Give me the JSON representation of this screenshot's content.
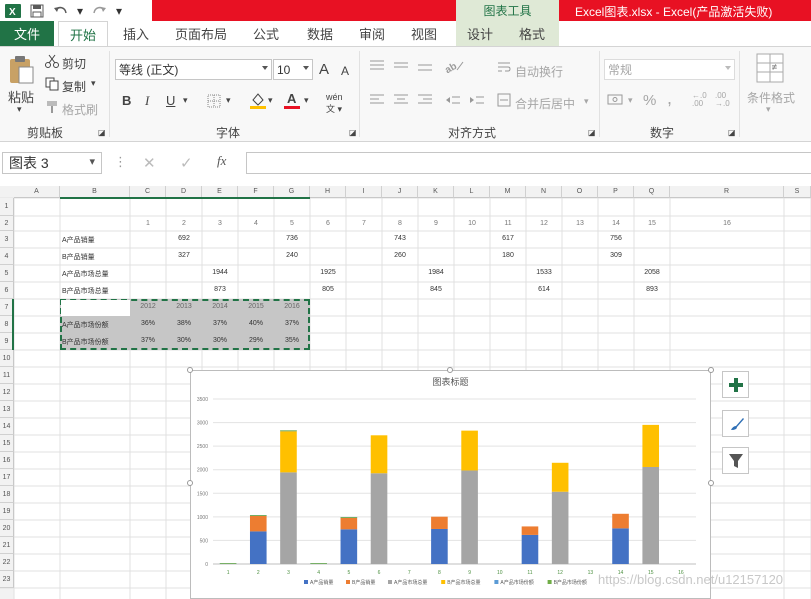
{
  "window": {
    "title": "Excel图表.xlsx -  Excel(产品激活失败)",
    "context_tab_group": "图表工具"
  },
  "tabs": [
    "文件",
    "开始",
    "插入",
    "页面布局",
    "公式",
    "数据",
    "审阅",
    "视图",
    "设计",
    "格式"
  ],
  "ribbon": {
    "clipboard": {
      "paste": "粘贴",
      "cut": "剪切",
      "copy": "复制",
      "format_painter": "格式刷",
      "label": "剪贴板"
    },
    "font": {
      "name": "等线 (正文)",
      "size": "10",
      "grow": "A",
      "shrink": "A",
      "bold": "B",
      "italic": "I",
      "underline": "U",
      "label": "字体"
    },
    "alignment": {
      "wrap": "自动换行",
      "merge": "合并后居中",
      "label": "对齐方式"
    },
    "number": {
      "format": "常规",
      "percent": "%",
      "comma": ",",
      "label": "数字"
    },
    "styles": {
      "conditional": "条件格式"
    }
  },
  "formula_bar": {
    "name_box": "图表 3",
    "cancel": "✕",
    "enter": "✓",
    "fx": "fx",
    "value": ""
  },
  "columns": [
    "A",
    "B",
    "C",
    "D",
    "E",
    "F",
    "G",
    "H",
    "I",
    "J",
    "K",
    "L",
    "M",
    "N",
    "O",
    "P",
    "Q",
    "R",
    "S"
  ],
  "rows": [
    "1",
    "2",
    "3",
    "4",
    "5",
    "6",
    "7",
    "8",
    "9",
    "10",
    "11",
    "12",
    "13",
    "14",
    "15",
    "16",
    "17",
    "18",
    "19",
    "20",
    "21",
    "22",
    "23"
  ],
  "sheet": {
    "row2_numbers": [
      "1",
      "2",
      "3",
      "4",
      "5",
      "6",
      "7",
      "8",
      "9",
      "10",
      "11",
      "12",
      "13",
      "14",
      "15",
      "16"
    ],
    "labels": [
      "A产品销量",
      "B产品销量",
      "A产品市场总量",
      "B产品市场总量",
      "A产品市场份额",
      "B产品市场份额"
    ],
    "row3": {
      "d": "692",
      "g": "736",
      "j": "743",
      "m": "617",
      "p": "756"
    },
    "row4": {
      "d": "327",
      "g": "240",
      "j": "260",
      "m": "180",
      "p": "309"
    },
    "row5": {
      "e": "1944",
      "h": "1925",
      "k": "1984",
      "n": "1533",
      "q": "2058"
    },
    "row6": {
      "e": "873",
      "h": "805",
      "k": "845",
      "n": "614",
      "q": "893"
    },
    "years": [
      "2012",
      "2013",
      "2014",
      "2015",
      "2016"
    ],
    "share_a": [
      "36%",
      "38%",
      "37%",
      "40%",
      "37%"
    ],
    "share_b": [
      "37%",
      "30%",
      "30%",
      "29%",
      "35%"
    ]
  },
  "chart_data": {
    "type": "bar",
    "title": "图表标题",
    "categories": [
      "1",
      "2",
      "3",
      "4",
      "5",
      "6",
      "7",
      "8",
      "9",
      "10",
      "11",
      "12",
      "13",
      "14",
      "15",
      "16"
    ],
    "ylim": [
      0,
      3500
    ],
    "yticks": [
      "0",
      "500",
      "1000",
      "1500",
      "2000",
      "2500",
      "3000",
      "3500"
    ],
    "series": [
      {
        "name": "A产品销量",
        "color": "#4472c4",
        "values": [
          0,
          692,
          0,
          0,
          736,
          0,
          0,
          743,
          0,
          0,
          617,
          0,
          0,
          756,
          0,
          0
        ]
      },
      {
        "name": "B产品销量",
        "color": "#ed7d31",
        "values": [
          0,
          327,
          0,
          0,
          240,
          0,
          0,
          260,
          0,
          0,
          180,
          0,
          0,
          309,
          0,
          0
        ]
      },
      {
        "name": "A产品市场总量",
        "color": "#a5a5a5",
        "values": [
          0,
          0,
          1944,
          0,
          0,
          1925,
          0,
          0,
          1984,
          0,
          0,
          1533,
          0,
          0,
          2058,
          0
        ]
      },
      {
        "name": "B产品市场总量",
        "color": "#ffc000",
        "values": [
          0,
          0,
          873,
          0,
          0,
          805,
          0,
          0,
          845,
          0,
          0,
          614,
          0,
          0,
          893,
          0
        ]
      },
      {
        "name": "A产品市场份额",
        "color": "#5b9bd5",
        "values": [
          0.36,
          0.38,
          0.37,
          0.4,
          0.37,
          0,
          0,
          0,
          0,
          0,
          0,
          0,
          0,
          0,
          0,
          0
        ]
      },
      {
        "name": "B产品市场份额",
        "color": "#70ad47",
        "values": [
          0.37,
          0.3,
          0.3,
          0.29,
          0.35,
          0,
          0,
          0,
          0,
          0,
          0,
          0,
          0,
          0,
          0,
          0
        ]
      }
    ],
    "legend": "bottom"
  },
  "watermark": "https://blog.csdn.net/u12157120",
  "colors": {
    "excel_green": "#217346",
    "title_red": "#e81123",
    "context_green": "#dfe9d6"
  }
}
